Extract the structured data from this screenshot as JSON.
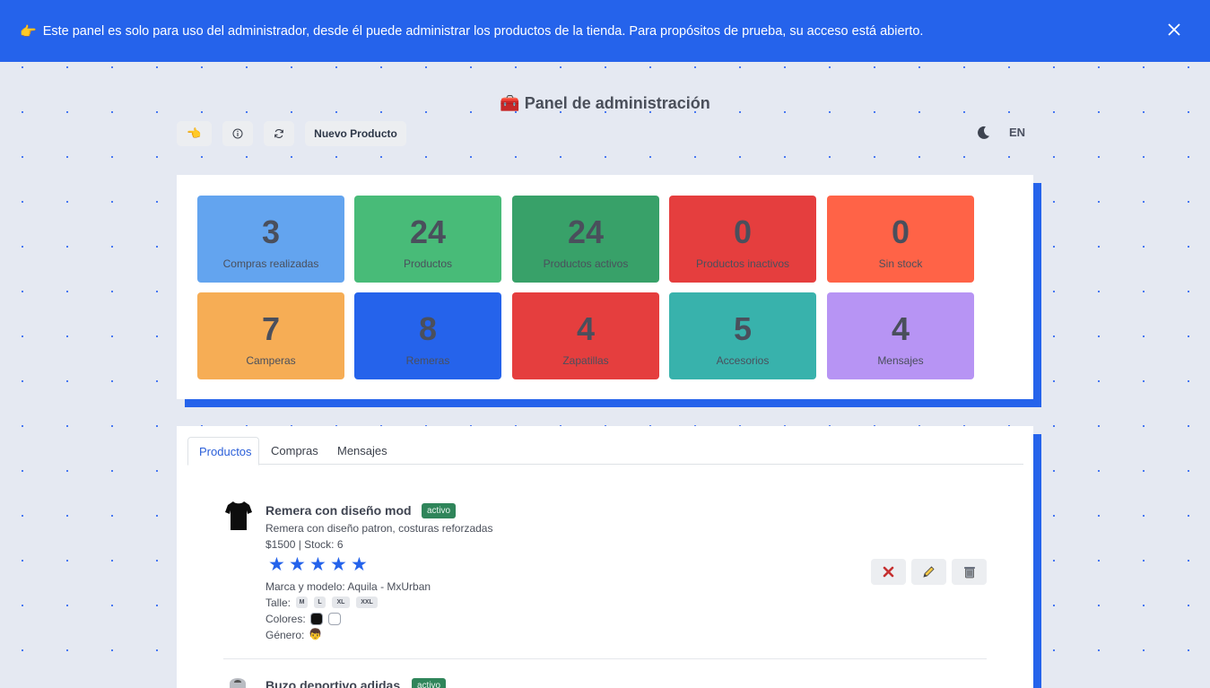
{
  "banner": {
    "icon": "pointing-hand-icon",
    "message": "Este panel es solo para uso del administrador, desde él puede administrar los productos de la tienda. Para propósitos de prueba, su acceso está abierto.",
    "close_icon": "close-icon"
  },
  "header": {
    "title_icon": "toolbox-icon",
    "title": "Panel de administración"
  },
  "toolbar": {
    "back_icon": "pointing-hand-icon",
    "info_icon": "info-icon",
    "refresh_icon": "refresh-icon",
    "new_product_label": "Nuevo Producto",
    "theme_icon": "moon-icon",
    "language_label": "EN"
  },
  "stats": [
    {
      "value": "3",
      "label": "Compras realizadas",
      "color": "#63a4ef"
    },
    {
      "value": "24",
      "label": "Productos",
      "color": "#48bb78"
    },
    {
      "value": "24",
      "label": "Productos activos",
      "color": "#38a169"
    },
    {
      "value": "0",
      "label": "Productos inactivos",
      "color": "#e53e3e"
    },
    {
      "value": "0",
      "label": "Sin stock",
      "color": "#ff6347"
    },
    {
      "value": "7",
      "label": "Camperas",
      "color": "#f6ad55"
    },
    {
      "value": "8",
      "label": "Remeras",
      "color": "#2563eb"
    },
    {
      "value": "4",
      "label": "Zapatillas",
      "color": "#e53e3e"
    },
    {
      "value": "5",
      "label": "Accesorios",
      "color": "#38b2ac"
    },
    {
      "value": "4",
      "label": "Mensajes",
      "color": "#b794f4"
    }
  ],
  "tabs": [
    {
      "label": "Productos",
      "active": true
    },
    {
      "label": "Compras",
      "active": false
    },
    {
      "label": "Mensajes",
      "active": false
    }
  ],
  "products": [
    {
      "image_icon": "tshirt-icon",
      "name": "Remera con diseño mod",
      "status": "activo",
      "description": "Remera con diseño patron, costuras reforzadas",
      "price_stock": "$1500 | Stock: 6",
      "rating": 5,
      "brand_model": "Marca y modelo: Aquila - MxUrban",
      "sizes_label": "Talle:",
      "sizes": [
        "M",
        "L",
        "XL",
        "XXL"
      ],
      "colors_label": "Colores:",
      "colors": [
        "#111111",
        "#ffffff"
      ],
      "gender_label": "Género:",
      "gender_icon": "boy-face-icon",
      "actions": [
        "deactivate-icon",
        "pencil-icon",
        "trash-icon"
      ]
    },
    {
      "image_icon": "hoodie-icon",
      "name": "Buzo deportivo adidas",
      "status": "activo"
    }
  ]
}
